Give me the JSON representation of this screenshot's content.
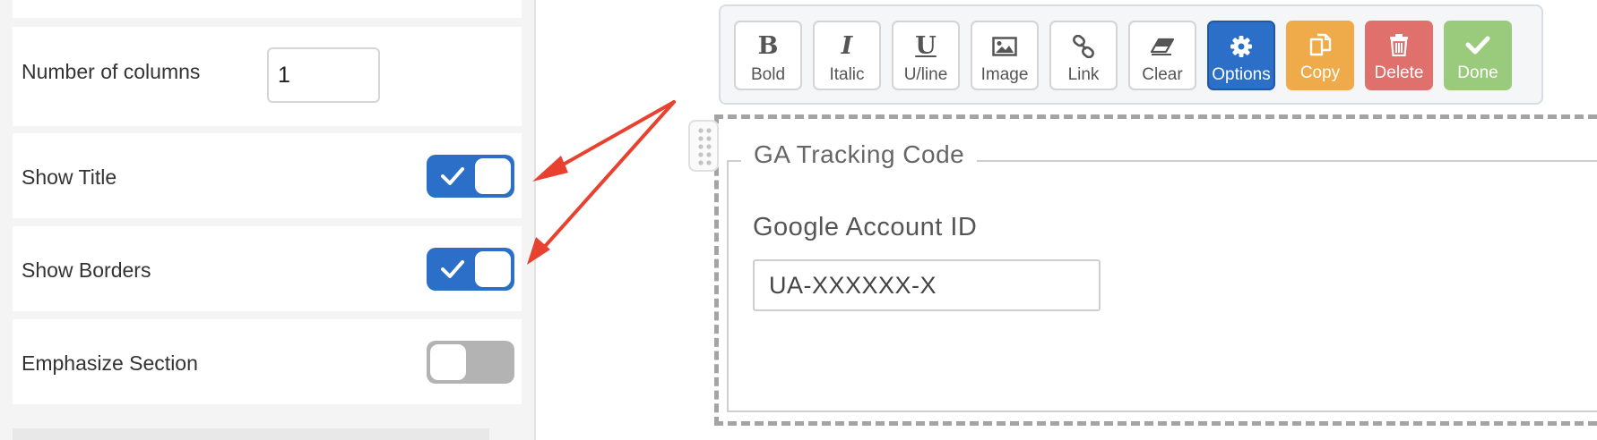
{
  "settings": {
    "columns_label": "Number of columns",
    "columns_value": "1",
    "toggles": [
      {
        "label": "Show Title",
        "on": true
      },
      {
        "label": "Show Borders",
        "on": true
      },
      {
        "label": "Emphasize Section",
        "on": false
      }
    ]
  },
  "toolbar": {
    "buttons": [
      {
        "label": "Bold",
        "icon": "bold-icon",
        "glyph": "B"
      },
      {
        "label": "Italic",
        "icon": "italic-icon",
        "glyph": "I"
      },
      {
        "label": "U/line",
        "icon": "underline-icon",
        "glyph": "U"
      },
      {
        "label": "Image",
        "icon": "image-icon"
      },
      {
        "label": "Link",
        "icon": "link-icon"
      },
      {
        "label": "Clear",
        "icon": "eraser-icon"
      },
      {
        "label": "Options",
        "icon": "gear-icon"
      },
      {
        "label": "Copy",
        "icon": "copy-icon"
      },
      {
        "label": "Delete",
        "icon": "trash-icon"
      },
      {
        "label": "Done",
        "icon": "check-icon"
      }
    ]
  },
  "section": {
    "legend": "GA Tracking Code",
    "field_label": "Google Account ID",
    "field_value": "UA-XXXXXX-X"
  },
  "colors": {
    "accent": "#2b6fc9",
    "copy": "#efaa4a",
    "delete": "#e0706b",
    "done": "#9acb7c",
    "annotation_arrow": "#e8412f"
  }
}
